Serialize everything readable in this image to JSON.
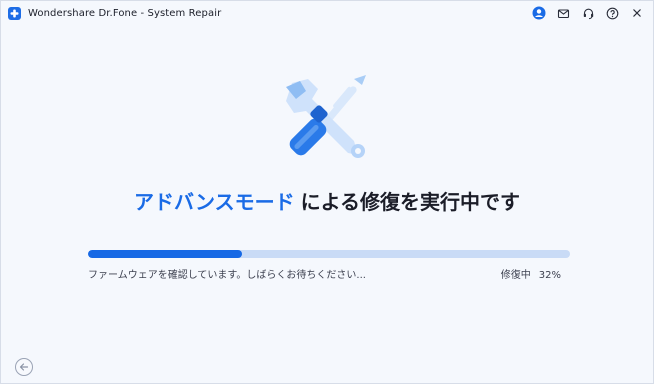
{
  "titlebar": {
    "app_title": "Wondershare Dr.Fone - System Repair",
    "icons": [
      "account-icon",
      "mail-icon",
      "headset-icon",
      "help-icon",
      "close-icon"
    ],
    "close_glyph": "✕"
  },
  "main": {
    "headline_accent": "アドバンスモード",
    "headline_rest": "による修復を実行中です",
    "status_message": "ファームウェアを確認しています。しばらくお待ちください...",
    "progress_label": "修復中",
    "progress_percent_text": "32%",
    "progress_value": 0.32
  },
  "colors": {
    "accent": "#1a6be6",
    "progress_track": "#c9dbf6",
    "background": "#f5f8fd"
  }
}
